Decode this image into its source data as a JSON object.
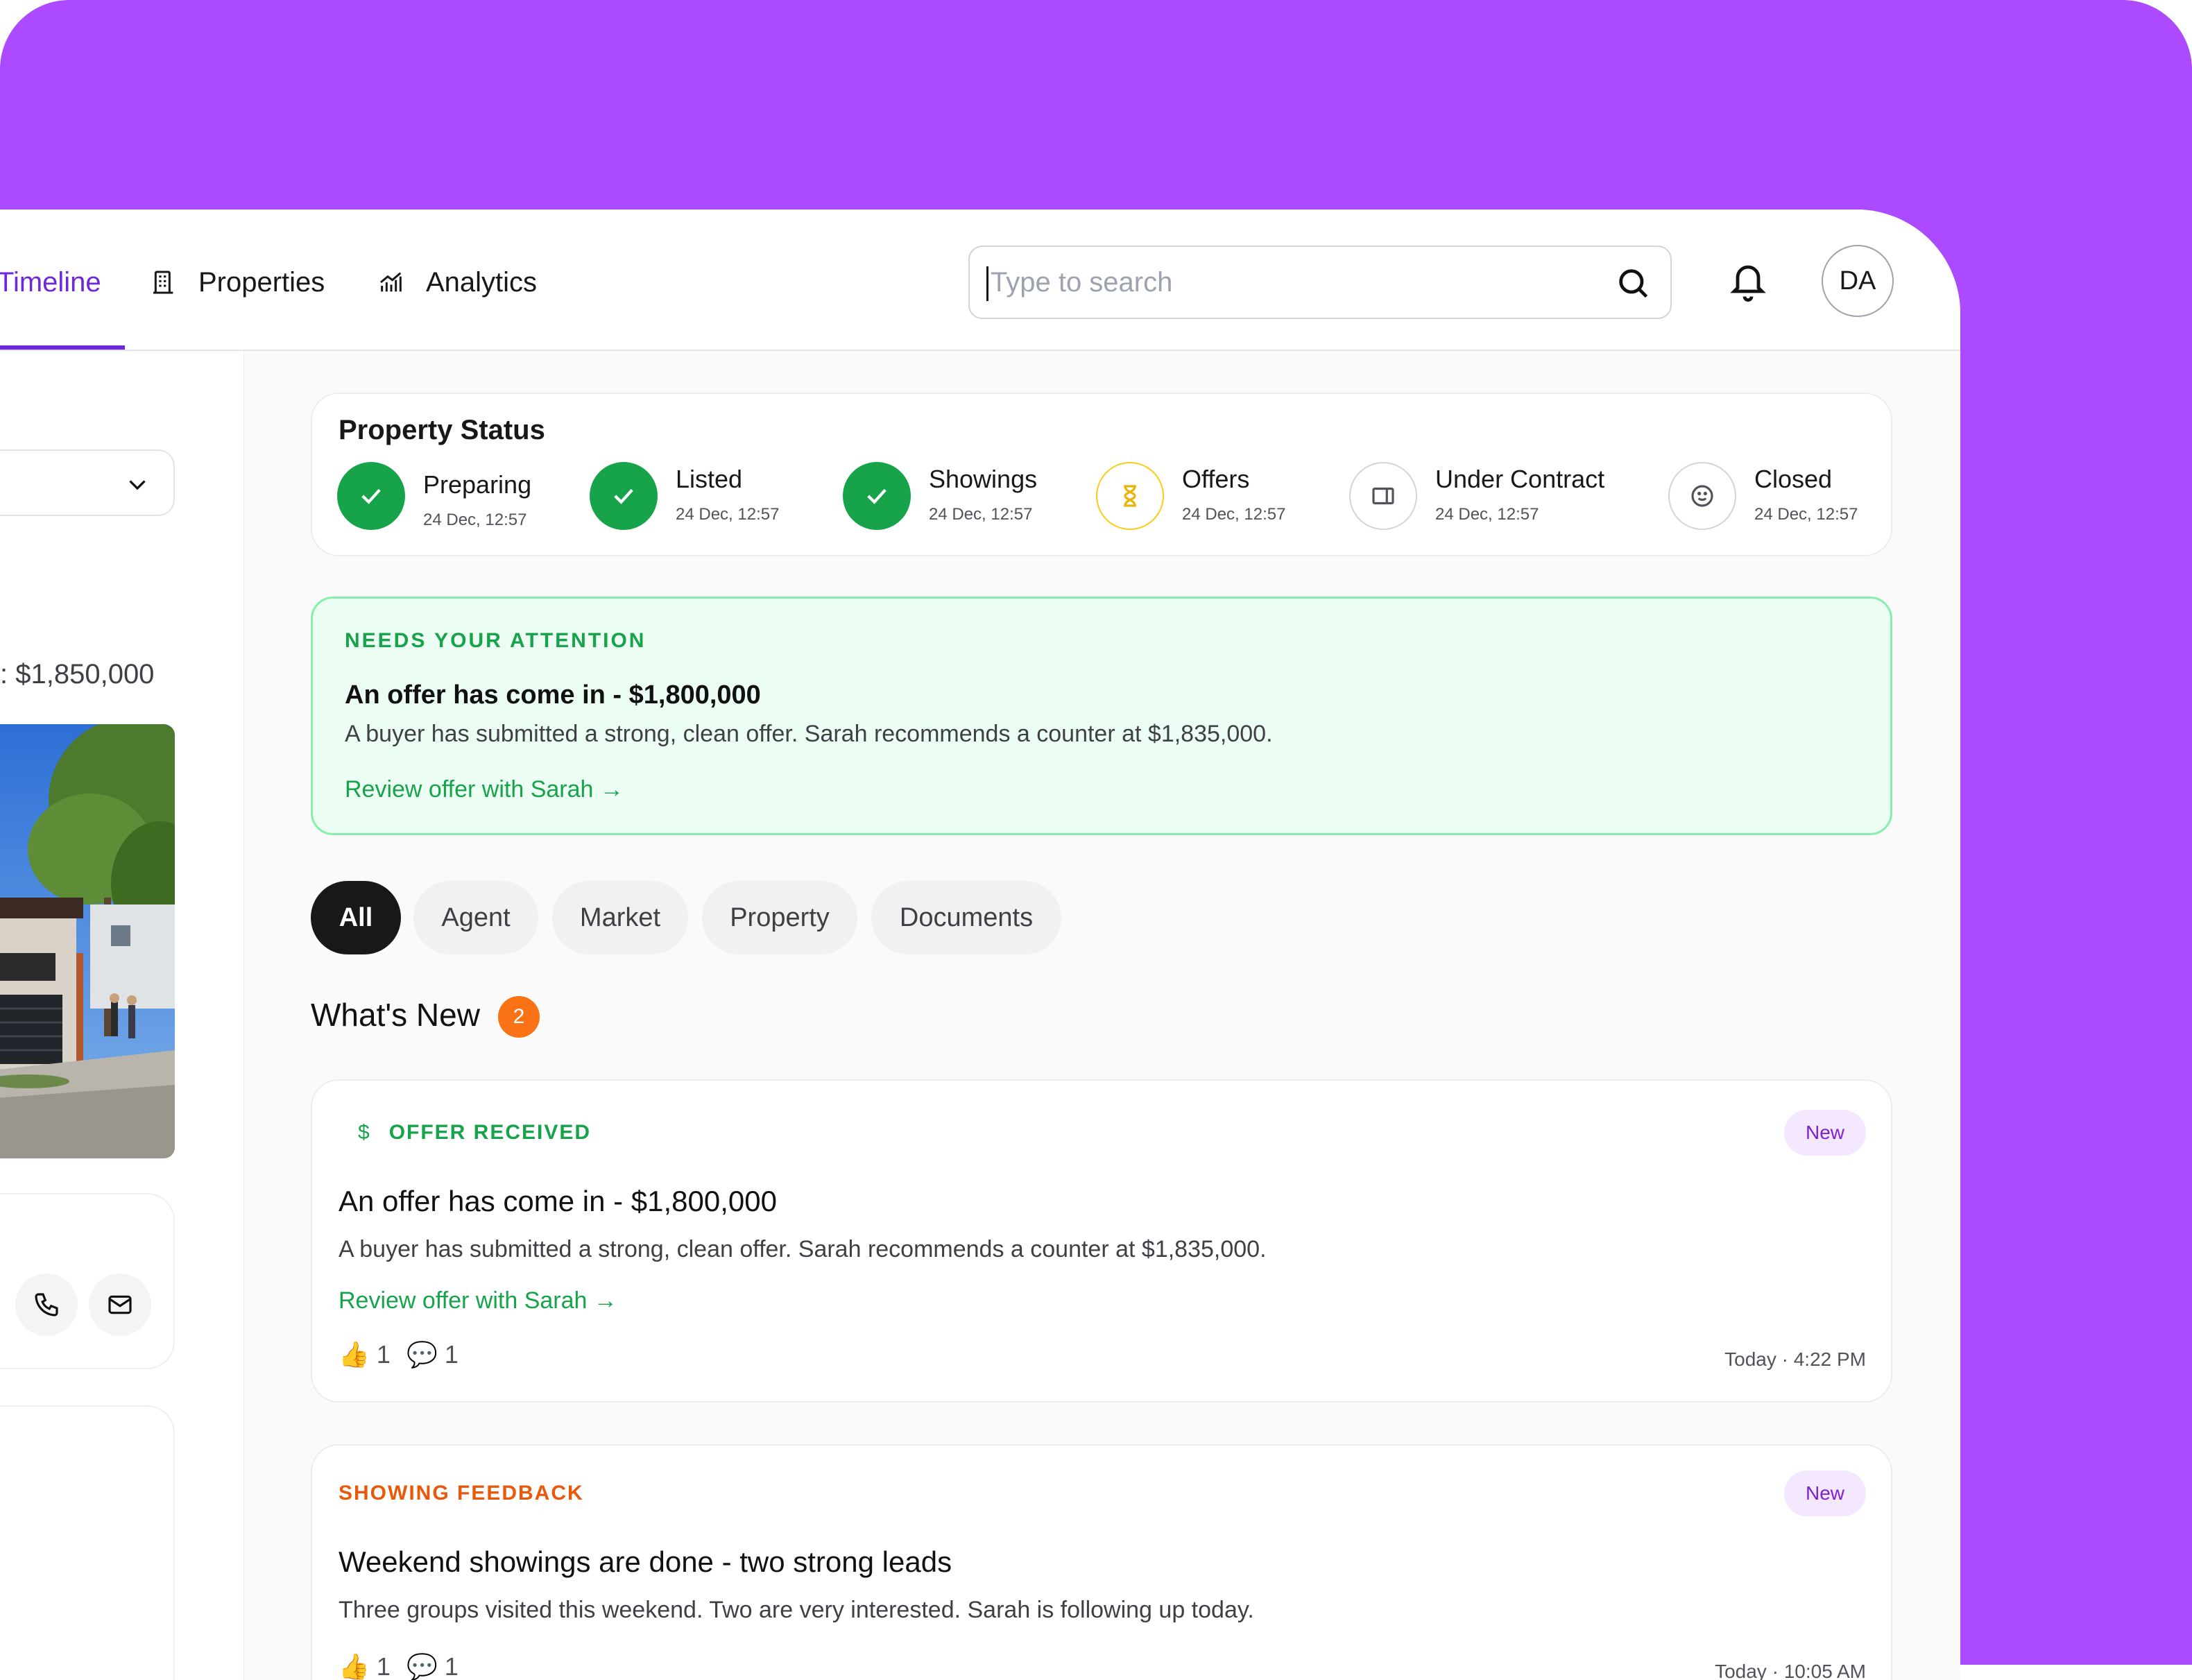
{
  "nav": {
    "items": [
      {
        "label": "Timeline",
        "icon": "timeline",
        "active": true
      },
      {
        "label": "Properties",
        "icon": "building-icon"
      },
      {
        "label": "Analytics",
        "icon": "analytics-chart-icon"
      }
    ]
  },
  "search": {
    "placeholder": "Type to search",
    "value": ""
  },
  "header": {
    "avatar_initials": "DA"
  },
  "left": {
    "price": "$1,850,000"
  },
  "status": {
    "title": "Property Status",
    "steps": [
      {
        "name": "Preparing",
        "date": "24 Dec, 12:57",
        "state": "done"
      },
      {
        "name": "Listed",
        "date": "24 Dec, 12:57",
        "state": "done"
      },
      {
        "name": "Showings",
        "date": "24 Dec, 12:57",
        "state": "done"
      },
      {
        "name": "Offers",
        "date": "24 Dec, 12:57",
        "state": "current"
      },
      {
        "name": "Under Contract",
        "date": "24 Dec, 12:57",
        "state": "todo"
      },
      {
        "name": "Closed",
        "date": "24 Dec, 12:57",
        "state": "todo"
      }
    ]
  },
  "attention": {
    "kicker": "NEEDS YOUR ATTENTION",
    "title": "An offer has come in - $1,800,000",
    "description": "A buyer has submitted a strong, clean offer. Sarah recommends a counter at $1,835,000.",
    "link": "Review offer with Sarah →"
  },
  "filters": {
    "chips": [
      "All",
      "Agent",
      "Market",
      "Property",
      "Documents"
    ],
    "active": "All"
  },
  "whats_new": {
    "title": "What's New",
    "count": "2"
  },
  "feed": [
    {
      "kicker_icon": "$",
      "kicker": "OFFER RECEIVED",
      "kicker_color": "#16a34a",
      "badge": "New",
      "title": "An offer has come in - $1,800,000",
      "description": "A buyer has submitted a strong, clean offer. Sarah recommends a counter at $1,835,000.",
      "link": "Review offer with Sarah →",
      "likes": "1",
      "comments": "1",
      "time": "Today · 4:22 PM"
    },
    {
      "kicker": "SHOWING FEEDBACK",
      "kicker_color": "#ea580c",
      "badge": "New",
      "title": "Weekend showings are done - two strong leads",
      "description": "Three groups visited this weekend. Two are very interested. Sarah is following up today.",
      "likes": "1",
      "comments": "1",
      "time": "Today · 10:05 AM"
    }
  ],
  "colors": {
    "background": "#ab4aff",
    "accent": "#6d28d9",
    "success": "#16a34a",
    "warning": "#facc15",
    "notification": "#f97316"
  }
}
